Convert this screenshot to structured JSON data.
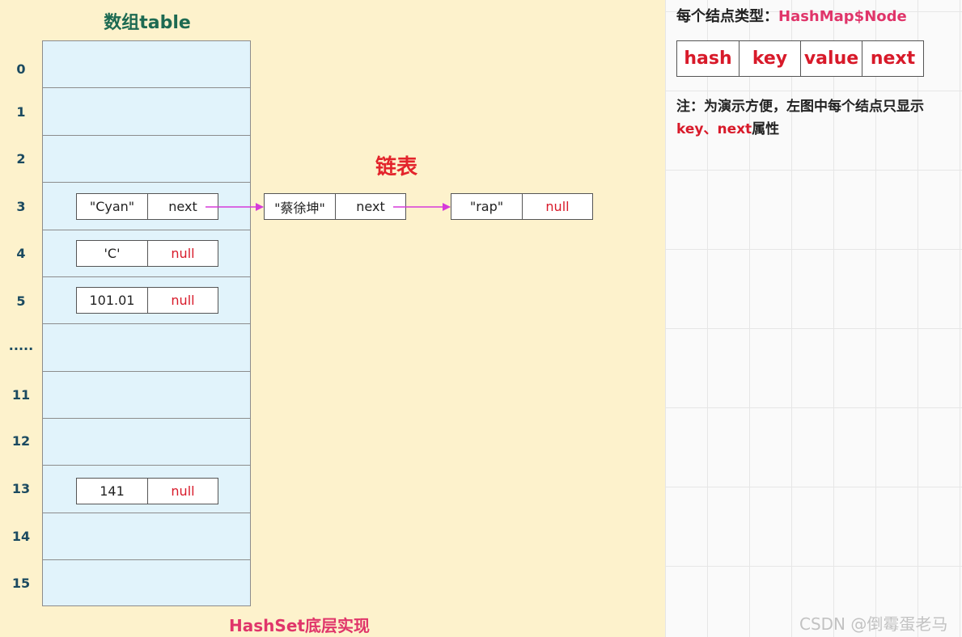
{
  "diagram": {
    "title": "数组table",
    "indices": [
      "0",
      "1",
      "2",
      "3",
      "4",
      "5",
      ".....",
      "11",
      "12",
      "13",
      "14",
      "15"
    ],
    "chain_title": "链表",
    "bottom_caption": "HashSet底层实现",
    "nodes": {
      "row3": {
        "key": "\"Cyan\"",
        "next": "next"
      },
      "row4": {
        "key": "'C'",
        "next": "null"
      },
      "row5": {
        "key": "101.01",
        "next": "null"
      },
      "row13": {
        "key": "141",
        "next": "null"
      },
      "chain1": {
        "key": "\"蔡徐坤\"",
        "next": "next"
      },
      "chain2": {
        "key": "\"rap\"",
        "next": "null"
      }
    }
  },
  "info": {
    "type_prefix": "每个结点类型：",
    "type_name": "HashMap$Node",
    "fields": [
      "hash",
      "key",
      "value",
      "next"
    ],
    "note_text": "注：为演示方便，左图中每个结点只显示",
    "note_keys": "key、next",
    "note_suffix": "属性"
  },
  "watermark": "CSDN @倒霉蛋老马",
  "colors": {
    "table_fill": "#e1f3fb",
    "background": "#fdf2cc",
    "title": "#1d6a52",
    "null_text": "#d81a2a",
    "chain_title": "#e3242b",
    "arrow": "#d63ad9",
    "caption": "#e0356a"
  }
}
